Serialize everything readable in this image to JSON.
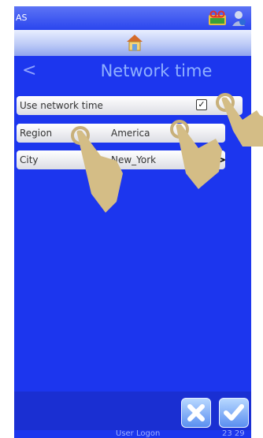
{
  "statusbar": {
    "user": "AS",
    "voicemail_icon": "voicemail-icon",
    "person_icon": "person-icon"
  },
  "homebar": {
    "home_icon": "home-icon"
  },
  "header": {
    "back": "<",
    "title": "Network time"
  },
  "settings": {
    "use_network_time": {
      "label": "Use network time",
      "checked": true,
      "check_glyph": "✓"
    },
    "region": {
      "label": "Region",
      "value": "America"
    },
    "city": {
      "label": "City",
      "value": "New_York",
      "chevron": ">"
    }
  },
  "footer": {
    "status": "User Logon",
    "time": "23 29"
  },
  "colors": {
    "background": "#1c36ee",
    "row": "#ffffff",
    "title": "#8fb0ff"
  }
}
